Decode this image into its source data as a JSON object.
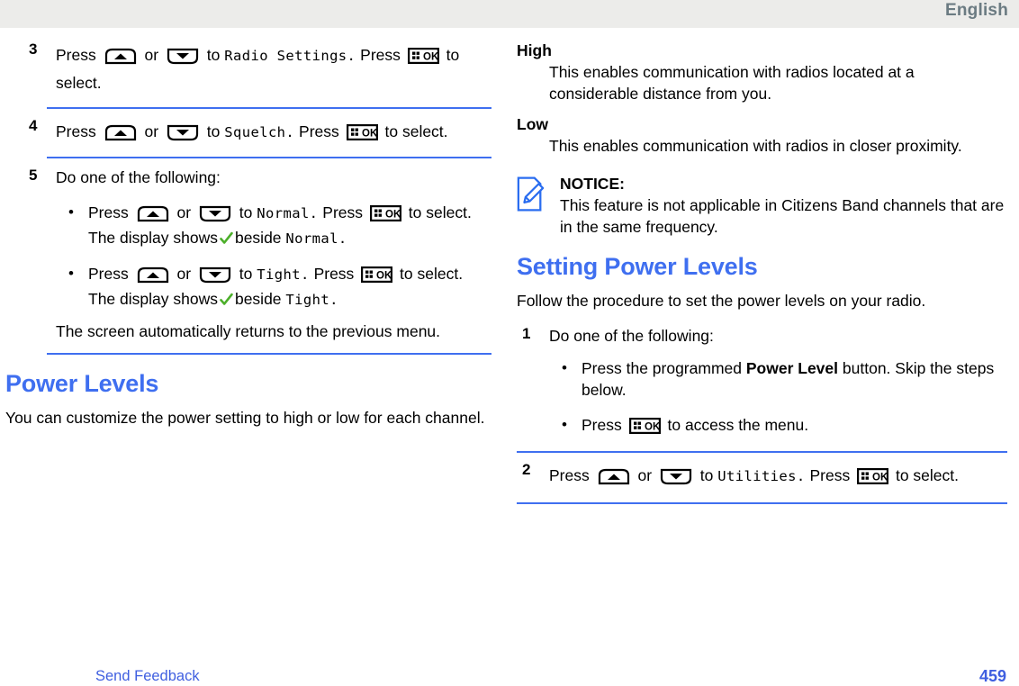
{
  "header": {
    "language": "English"
  },
  "left_column": {
    "steps": [
      {
        "number": "3",
        "prefix": "Press",
        "mid": "or",
        "to": "to",
        "target": "Radio Settings.",
        "press2": "Press",
        "suffix": "to select."
      },
      {
        "number": "4",
        "prefix": "Press",
        "mid": "or",
        "to": "to",
        "target": "Squelch.",
        "press2": "Press",
        "suffix": "to select."
      },
      {
        "number": "5",
        "intro": "Do one of the following:"
      }
    ],
    "bullets": [
      {
        "prefix": "Press",
        "mid": "or",
        "to": "to",
        "target": "Normal.",
        "press2": "Press",
        "suffix": "to select.",
        "display_prefix": "The display shows",
        "display_mid": "beside",
        "display_target": "Normal."
      },
      {
        "prefix": "Press",
        "mid": "or",
        "to": "to",
        "target": "Tight.",
        "press2": "Press",
        "suffix": "to select.",
        "display_prefix": "The display shows",
        "display_mid": "beside",
        "display_target": "Tight."
      }
    ],
    "closing_note": "The screen automatically returns to the previous menu.",
    "section": {
      "heading": "Power Levels",
      "paragraph": "You can customize the power setting to high or low for each channel."
    }
  },
  "right_column": {
    "definitions": [
      {
        "term": "High",
        "definition": "This enables communication with radios located at a considerable distance from you."
      },
      {
        "term": "Low",
        "definition": "This enables communication with radios in closer proximity."
      }
    ],
    "notice": {
      "title": "NOTICE:",
      "text": "This feature is not applicable in Citizens Band channels that are in the same frequency."
    },
    "section": {
      "heading": "Setting Power Levels",
      "paragraph": "Follow the procedure to set the power levels on your radio."
    },
    "steps": [
      {
        "number": "1",
        "intro": "Do one of the following:",
        "bullets": [
          {
            "text_before": "Press the programmed",
            "bold": "Power Level",
            "text_after": "button. Skip the steps below."
          },
          {
            "text_before": "Press",
            "text_after": "to access the menu."
          }
        ]
      },
      {
        "number": "2",
        "prefix": "Press",
        "mid": "or",
        "to": "to",
        "target": "Utilities.",
        "press2": "Press",
        "suffix": "to select."
      }
    ]
  },
  "footer": {
    "feedback_link": "Send Feedback",
    "page_number": "459"
  },
  "icons": {
    "up_key": "arrow-up-key-icon",
    "down_key": "arrow-down-key-icon",
    "ok_key": "menu-ok-key-icon",
    "check": "green-check-icon",
    "notice": "notice-pencil-icon"
  },
  "colors": {
    "accent_blue": "#3f6ff0",
    "link_blue": "#3f5fe0",
    "header_gray": "#ececea",
    "header_text": "#6b7b82",
    "check_green": "#4caf2a"
  }
}
